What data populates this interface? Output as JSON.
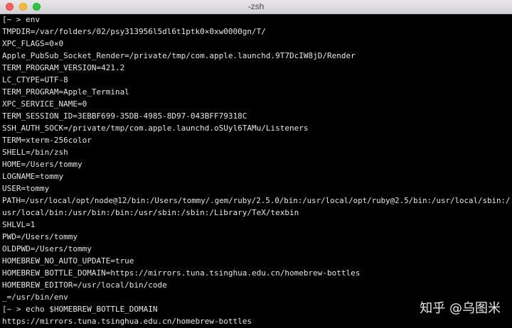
{
  "window": {
    "title": "-zsh"
  },
  "terminal": {
    "lines": [
      "[~ > env",
      "TMPDIR=/var/folders/02/psy313956l5dl6t1ptk0×0xw0000gn/T/",
      "XPC_FLAGS=0×0",
      "Apple_PubSub_Socket_Render=/private/tmp/com.apple.launchd.9T7DcIW8jD/Render",
      "TERM_PROGRAM_VERSION=421.2",
      "LC_CTYPE=UTF-8",
      "TERM_PROGRAM=Apple_Terminal",
      "XPC_SERVICE_NAME=0",
      "TERM_SESSION_ID=3EBBF699-35DB-4985-8D97-043BFF79318C",
      "SSH_AUTH_SOCK=/private/tmp/com.apple.launchd.oSUyl6TAMu/Listeners",
      "TERM=xterm-256color",
      "SHELL=/bin/zsh",
      "HOME=/Users/tommy",
      "LOGNAME=tommy",
      "USER=tommy",
      "PATH=/usr/local/opt/node@12/bin:/Users/tommy/.gem/ruby/2.5.0/bin:/usr/local/opt/ruby@2.5/bin:/usr/local/sbin:/",
      "usr/local/bin:/usr/bin:/bin:/usr/sbin:/sbin:/Library/TeX/texbin",
      "SHLVL=1",
      "PWD=/Users/tommy",
      "OLDPWD=/Users/tommy",
      "HOMEBREW_NO_AUTO_UPDATE=true",
      "HOMEBREW_BOTTLE_DOMAIN=https://mirrors.tuna.tsinghua.edu.cn/homebrew-bottles",
      "HOMEBREW_EDITOR=/usr/local/bin/code",
      "_=/usr/bin/env",
      "[~ > echo $HOMEBREW_BOTTLE_DOMAIN",
      "https://mirrors.tuna.tsinghua.edu.cn/homebrew-bottles"
    ]
  },
  "watermark": {
    "text": "知乎 @乌图米"
  }
}
